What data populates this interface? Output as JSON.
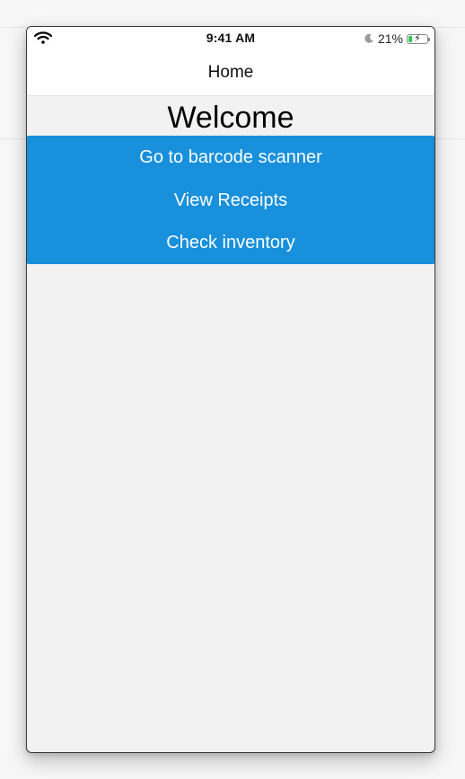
{
  "status_bar": {
    "time": "9:41 AM",
    "battery_percent_text": "21%",
    "battery_level": 0.21,
    "icons": [
      "wifi-icon",
      "moon-icon",
      "battery-charging-icon"
    ]
  },
  "nav": {
    "title": "Home"
  },
  "main": {
    "heading": "Welcome",
    "buttons": [
      {
        "label": "Go to barcode scanner"
      },
      {
        "label": "View Receipts"
      },
      {
        "label": "Check inventory"
      }
    ]
  },
  "colors": {
    "accent": "#1890dc",
    "background": "#f2f2f2",
    "battery_fill": "#34c759"
  }
}
